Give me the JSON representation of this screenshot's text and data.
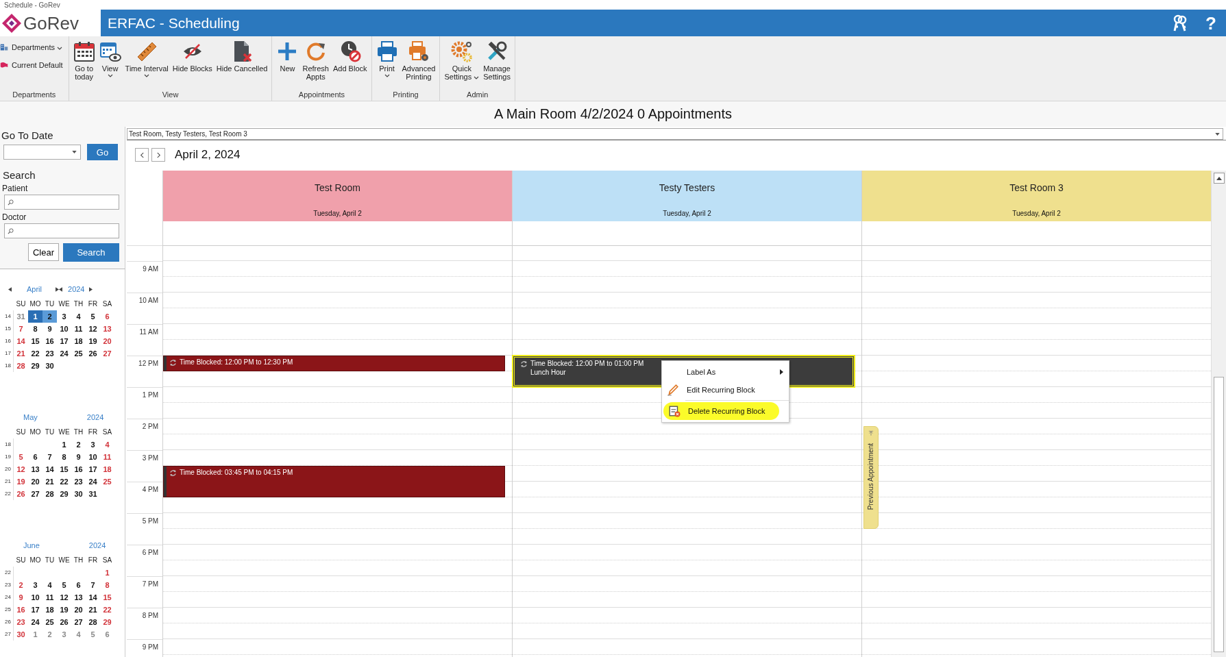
{
  "window": {
    "title": "Schedule - GoRev"
  },
  "header": {
    "logo": "GoRev",
    "title": "ERFAC - Scheduling",
    "help": "?"
  },
  "ribbon": [
    {
      "group": "Departments",
      "items": [
        {
          "label": [
            "Departments"
          ],
          "kind": "smallmenu"
        },
        {
          "label": [
            "Current Default"
          ],
          "kind": "small"
        }
      ]
    },
    {
      "group": "View",
      "items": [
        {
          "label": [
            "Go to",
            "today"
          ],
          "kind": "large"
        },
        {
          "label": [
            "View"
          ],
          "kind": "menu"
        },
        {
          "label": [
            "Time Interval"
          ],
          "kind": "menu"
        },
        {
          "label": [
            "Hide Blocks"
          ],
          "kind": "large"
        },
        {
          "label": [
            "Hide Cancelled"
          ],
          "kind": "large"
        }
      ]
    },
    {
      "group": "Appointments",
      "items": [
        {
          "label": [
            "New"
          ],
          "kind": "large"
        },
        {
          "label": [
            "Refresh",
            "Appts"
          ],
          "kind": "large"
        },
        {
          "label": [
            "Add Block"
          ],
          "kind": "large"
        }
      ]
    },
    {
      "group": "Printing",
      "items": [
        {
          "label": [
            "Print"
          ],
          "kind": "menu"
        },
        {
          "label": [
            "Advanced",
            "Printing"
          ],
          "kind": "large"
        }
      ]
    },
    {
      "group": "Admin",
      "items": [
        {
          "label": [
            "Quick",
            "Settings"
          ],
          "kind": "sidemenu"
        },
        {
          "label": [
            "Manage",
            "Settings"
          ],
          "kind": "large"
        }
      ]
    }
  ],
  "page_title": "A Main Room 4/2/2024 0 Appointments",
  "sidebar": {
    "go_to_date": {
      "heading": "Go To Date",
      "button": "Go"
    },
    "search": {
      "heading": "Search",
      "fields": [
        {
          "label": "Patient"
        },
        {
          "label": "Doctor"
        }
      ],
      "clear_button": "Clear",
      "search_button": "Search"
    }
  },
  "mini_calendars": [
    {
      "month": "April",
      "year": "2024",
      "nav": true,
      "weekdays": [
        "SU",
        "MO",
        "TU",
        "WE",
        "TH",
        "FR",
        "SA"
      ],
      "weeks": [
        {
          "number": "14",
          "days": [
            {
              "d": "31",
              "kind": "other"
            },
            {
              "d": "1",
              "kind": "today"
            },
            {
              "d": "2",
              "kind": "selected"
            },
            {
              "d": "3",
              "kind": "day"
            },
            {
              "d": "4",
              "kind": "day"
            },
            {
              "d": "5",
              "kind": "day"
            },
            {
              "d": "6",
              "kind": "day"
            }
          ]
        },
        {
          "number": "15",
          "days": [
            {
              "d": "7",
              "kind": "day"
            },
            {
              "d": "8",
              "kind": "day"
            },
            {
              "d": "9",
              "kind": "day"
            },
            {
              "d": "10",
              "kind": "day"
            },
            {
              "d": "11",
              "kind": "day"
            },
            {
              "d": "12",
              "kind": "day"
            },
            {
              "d": "13",
              "kind": "day"
            }
          ]
        },
        {
          "number": "16",
          "days": [
            {
              "d": "14",
              "kind": "day"
            },
            {
              "d": "15",
              "kind": "day"
            },
            {
              "d": "16",
              "kind": "day"
            },
            {
              "d": "17",
              "kind": "day"
            },
            {
              "d": "18",
              "kind": "day"
            },
            {
              "d": "19",
              "kind": "day"
            },
            {
              "d": "20",
              "kind": "day"
            }
          ]
        },
        {
          "number": "17",
          "days": [
            {
              "d": "21",
              "kind": "day"
            },
            {
              "d": "22",
              "kind": "day"
            },
            {
              "d": "23",
              "kind": "day"
            },
            {
              "d": "24",
              "kind": "day"
            },
            {
              "d": "25",
              "kind": "day"
            },
            {
              "d": "26",
              "kind": "day"
            },
            {
              "d": "27",
              "kind": "day"
            }
          ]
        },
        {
          "number": "18",
          "days": [
            {
              "d": "28",
              "kind": "day"
            },
            {
              "d": "29",
              "kind": "day"
            },
            {
              "d": "30",
              "kind": "day"
            }
          ]
        }
      ]
    },
    {
      "month": "May",
      "year": "2024",
      "nav": false,
      "weekdays": [
        "SU",
        "MO",
        "TU",
        "WE",
        "TH",
        "FR",
        "SA"
      ],
      "weeks": [
        {
          "number": "18",
          "days": [
            {
              "kind": "blank"
            },
            {
              "kind": "blank"
            },
            {
              "kind": "blank"
            },
            {
              "d": "1",
              "kind": "day"
            },
            {
              "d": "2",
              "kind": "day"
            },
            {
              "d": "3",
              "kind": "day"
            },
            {
              "d": "4",
              "kind": "day"
            }
          ]
        },
        {
          "number": "19",
          "days": [
            {
              "d": "5",
              "kind": "day"
            },
            {
              "d": "6",
              "kind": "day"
            },
            {
              "d": "7",
              "kind": "day"
            },
            {
              "d": "8",
              "kind": "day"
            },
            {
              "d": "9",
              "kind": "day"
            },
            {
              "d": "10",
              "kind": "day"
            },
            {
              "d": "11",
              "kind": "day"
            }
          ]
        },
        {
          "number": "20",
          "days": [
            {
              "d": "12",
              "kind": "day"
            },
            {
              "d": "13",
              "kind": "day"
            },
            {
              "d": "14",
              "kind": "day"
            },
            {
              "d": "15",
              "kind": "day"
            },
            {
              "d": "16",
              "kind": "day"
            },
            {
              "d": "17",
              "kind": "day"
            },
            {
              "d": "18",
              "kind": "day"
            }
          ]
        },
        {
          "number": "21",
          "days": [
            {
              "d": "19",
              "kind": "day"
            },
            {
              "d": "20",
              "kind": "day"
            },
            {
              "d": "21",
              "kind": "day"
            },
            {
              "d": "22",
              "kind": "day"
            },
            {
              "d": "23",
              "kind": "day"
            },
            {
              "d": "24",
              "kind": "day"
            },
            {
              "d": "25",
              "kind": "day"
            }
          ]
        },
        {
          "number": "22",
          "days": [
            {
              "d": "26",
              "kind": "day"
            },
            {
              "d": "27",
              "kind": "day"
            },
            {
              "d": "28",
              "kind": "day"
            },
            {
              "d": "29",
              "kind": "day"
            },
            {
              "d": "30",
              "kind": "day"
            },
            {
              "d": "31",
              "kind": "day"
            }
          ]
        }
      ]
    },
    {
      "month": "June",
      "year": "2024",
      "nav": false,
      "weekdays": [
        "SU",
        "MO",
        "TU",
        "WE",
        "TH",
        "FR",
        "SA"
      ],
      "weeks": [
        {
          "number": "22",
          "days": [
            {
              "kind": "blank"
            },
            {
              "kind": "blank"
            },
            {
              "kind": "blank"
            },
            {
              "kind": "blank"
            },
            {
              "kind": "blank"
            },
            {
              "kind": "blank"
            },
            {
              "d": "1",
              "kind": "day"
            }
          ]
        },
        {
          "number": "23",
          "days": [
            {
              "d": "2",
              "kind": "day"
            },
            {
              "d": "3",
              "kind": "day"
            },
            {
              "d": "4",
              "kind": "day"
            },
            {
              "d": "5",
              "kind": "day"
            },
            {
              "d": "6",
              "kind": "day"
            },
            {
              "d": "7",
              "kind": "day"
            },
            {
              "d": "8",
              "kind": "day"
            }
          ]
        },
        {
          "number": "24",
          "days": [
            {
              "d": "9",
              "kind": "day"
            },
            {
              "d": "10",
              "kind": "day"
            },
            {
              "d": "11",
              "kind": "day"
            },
            {
              "d": "12",
              "kind": "day"
            },
            {
              "d": "13",
              "kind": "day"
            },
            {
              "d": "14",
              "kind": "day"
            },
            {
              "d": "15",
              "kind": "day"
            }
          ]
        },
        {
          "number": "25",
          "days": [
            {
              "d": "16",
              "kind": "day"
            },
            {
              "d": "17",
              "kind": "day"
            },
            {
              "d": "18",
              "kind": "day"
            },
            {
              "d": "19",
              "kind": "day"
            },
            {
              "d": "20",
              "kind": "day"
            },
            {
              "d": "21",
              "kind": "day"
            },
            {
              "d": "22",
              "kind": "day"
            }
          ]
        },
        {
          "number": "26",
          "days": [
            {
              "d": "23",
              "kind": "day"
            },
            {
              "d": "24",
              "kind": "day"
            },
            {
              "d": "25",
              "kind": "day"
            },
            {
              "d": "26",
              "kind": "day"
            },
            {
              "d": "27",
              "kind": "day"
            },
            {
              "d": "28",
              "kind": "day"
            },
            {
              "d": "29",
              "kind": "day"
            }
          ]
        },
        {
          "number": "27",
          "days": [
            {
              "d": "30",
              "kind": "day"
            },
            {
              "d": "1",
              "kind": "other"
            },
            {
              "d": "2",
              "kind": "other"
            },
            {
              "d": "3",
              "kind": "other"
            },
            {
              "d": "4",
              "kind": "other"
            },
            {
              "d": "5",
              "kind": "other"
            },
            {
              "d": "6",
              "kind": "other"
            }
          ]
        }
      ]
    }
  ],
  "resource_selector": {
    "value": "Test Room, Testy Testers, Test Room 3"
  },
  "date_nav": {
    "date": "April 2, 2024"
  },
  "time_labels": [
    "9 AM",
    "10 AM",
    "11 AM",
    "12 PM",
    "1 PM",
    "2 PM",
    "3 PM",
    "4 PM",
    "5 PM",
    "6 PM",
    "7 PM",
    "8 PM",
    "9 PM"
  ],
  "columns": [
    {
      "name": "Test Room",
      "date": "Tuesday, April 2",
      "color": "#f0a0ab",
      "blocks": [
        {
          "text": "Time Blocked: 12:00 PM to 12:30 PM",
          "color": "#8b1518",
          "selected": false
        },
        {
          "text": "Time Blocked: 03:45 PM to 04:15 PM",
          "color": "#8b1518",
          "selected": false
        }
      ]
    },
    {
      "name": "Testy Testers",
      "date": "Tuesday, April 2",
      "color": "#bde0f6",
      "blocks": [
        {
          "text": "Time Blocked: 12:00 PM to 01:00 PM",
          "note": "Lunch Hour",
          "color": "#3c3c3c",
          "selected": true
        }
      ]
    },
    {
      "name": "Test Room 3",
      "date": "Tuesday, April 2",
      "color": "#efe08e",
      "side_tab": "Previous Appointment"
    }
  ],
  "context_menu": [
    {
      "label": "Label As",
      "submenu": true,
      "highlighted": false
    },
    {
      "label": "Edit Recurring Block",
      "submenu": false,
      "highlighted": false
    },
    {
      "label": "Delete Recurring Block",
      "submenu": false,
      "highlighted": true
    }
  ]
}
